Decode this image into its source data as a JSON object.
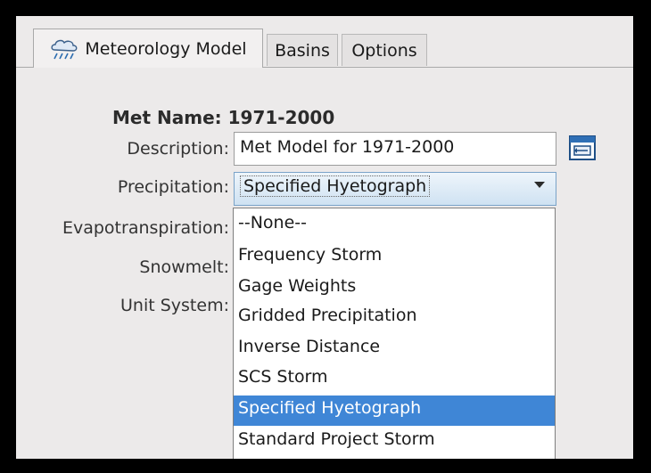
{
  "tabs": [
    {
      "label": "Meteorology Model",
      "active": true
    },
    {
      "label": "Basins",
      "active": false
    },
    {
      "label": "Options",
      "active": false
    }
  ],
  "form": {
    "met_name_label": "Met Name:",
    "met_name_value": "1971-2000",
    "description_label": "Description:",
    "description_value": "Met Model for 1971-2000",
    "precipitation_label": "Precipitation:",
    "precipitation_value": "Specified Hyetograph",
    "evapotranspiration_label": "Evapotranspiration:",
    "snowmelt_label": "Snowmelt:",
    "unit_system_label": "Unit System:"
  },
  "dropdown": {
    "options": [
      "--None--",
      "Frequency Storm",
      "Gage Weights",
      "Gridded Precipitation",
      "Inverse Distance",
      "SCS Storm",
      "Specified Hyetograph",
      "Standard Project Storm"
    ],
    "selected": "Specified Hyetograph"
  },
  "icons": {
    "tab_icon": "cloud-rain-icon",
    "description_button_icon": "edit-window-icon"
  },
  "colors": {
    "selection": "#3f86d6",
    "combo_border": "#7aa3c8"
  }
}
